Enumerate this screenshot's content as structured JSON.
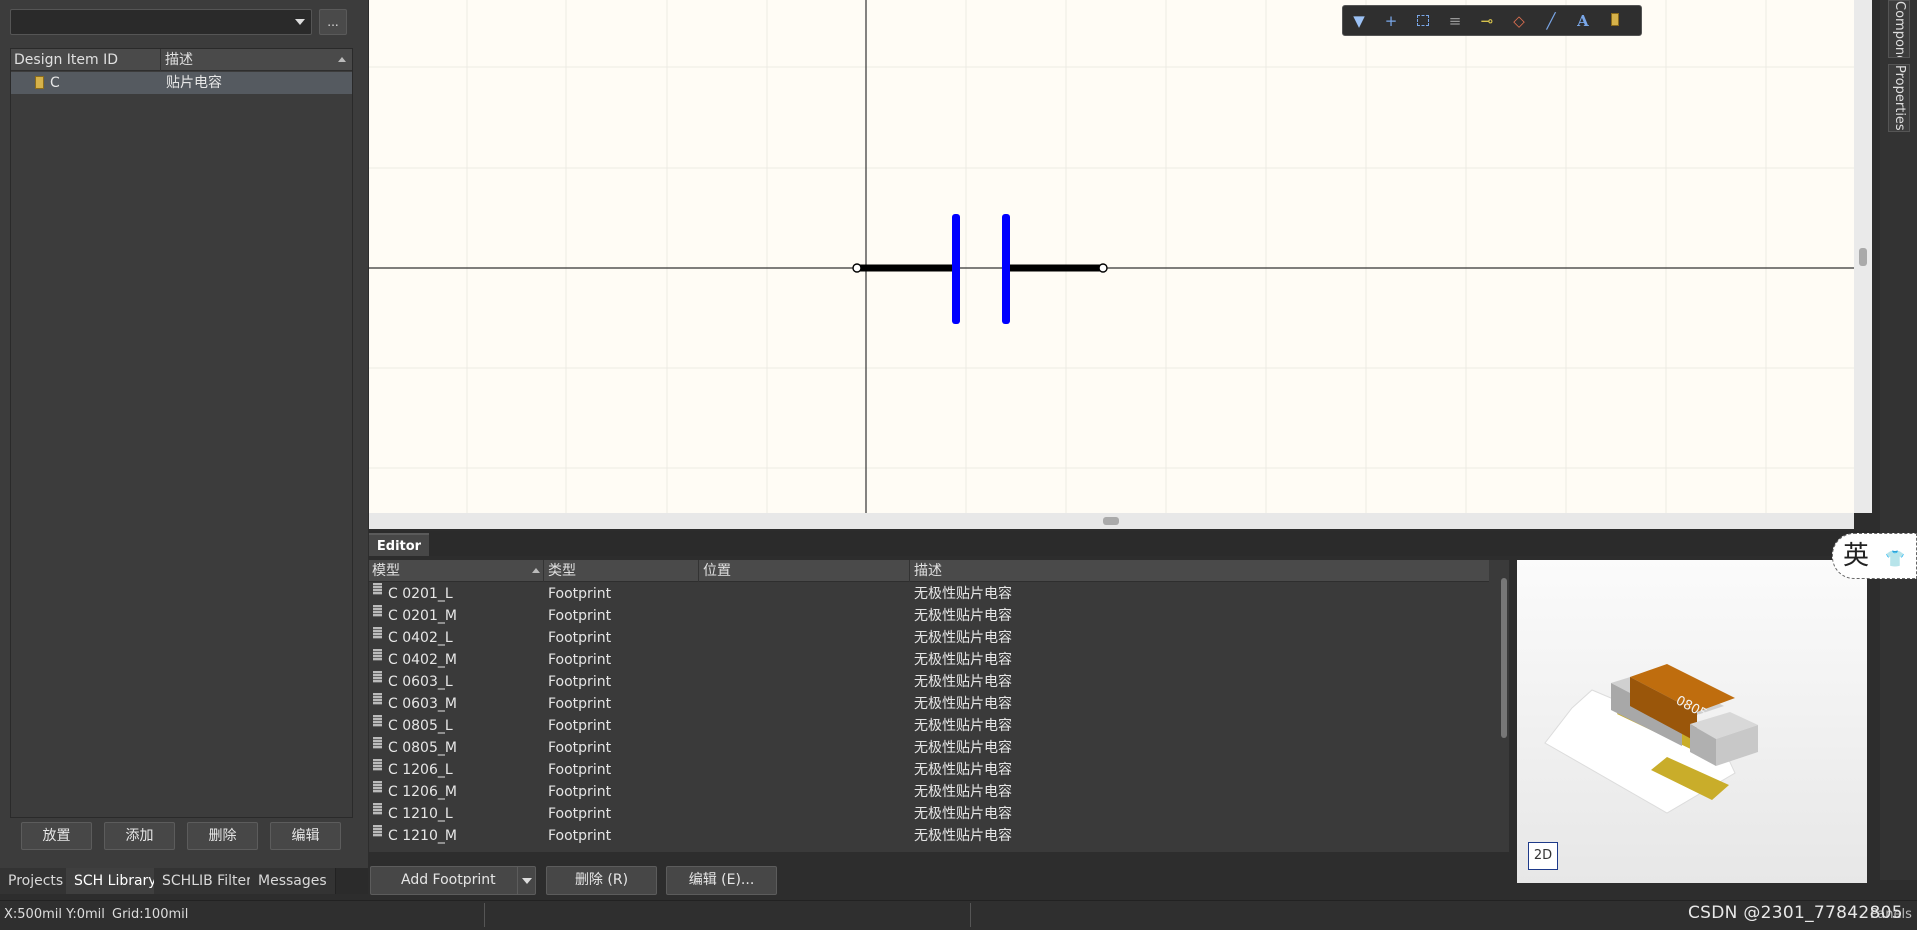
{
  "left_panel": {
    "combo_value": "",
    "more_button": "...",
    "table": {
      "headers": [
        "Design Item ID",
        "描述"
      ],
      "rows": [
        {
          "id": "C",
          "desc": "贴片电容"
        }
      ]
    },
    "buttons": [
      "放置",
      "添加",
      "删除",
      "编辑"
    ],
    "tabs": [
      "Projects",
      "SCH Library",
      "SCHLIB Filter",
      "Messages"
    ]
  },
  "canvas": {
    "background": "#fffcf5",
    "grid_color": "#ecebe4",
    "axis_color": "#333333",
    "pin_color": "#000000",
    "plate_color": "#0000ff",
    "toolbar_icons": [
      "filter-icon",
      "cross-icon",
      "select-rect-icon",
      "align-icon",
      "pin-icon",
      "fill-icon",
      "line-icon",
      "text-icon",
      "component-icon"
    ]
  },
  "right_strip": {
    "tabs": [
      "Components",
      "Properties"
    ]
  },
  "editor": {
    "tab": "Editor",
    "headers": [
      "模型",
      "类型",
      "位置",
      "描述"
    ],
    "rows": [
      {
        "model": "C 0201_L",
        "type": "Footprint",
        "location": "",
        "desc": "无极性贴片电容"
      },
      {
        "model": "C 0201_M",
        "type": "Footprint",
        "location": "",
        "desc": "无极性贴片电容"
      },
      {
        "model": "C 0402_L",
        "type": "Footprint",
        "location": "",
        "desc": "无极性贴片电容"
      },
      {
        "model": "C 0402_M",
        "type": "Footprint",
        "location": "",
        "desc": "无极性贴片电容"
      },
      {
        "model": "C 0603_L",
        "type": "Footprint",
        "location": "",
        "desc": "无极性贴片电容"
      },
      {
        "model": "C 0603_M",
        "type": "Footprint",
        "location": "",
        "desc": "无极性贴片电容"
      },
      {
        "model": "C 0805_L",
        "type": "Footprint",
        "location": "",
        "desc": "无极性贴片电容"
      },
      {
        "model": "C 0805_M",
        "type": "Footprint",
        "location": "",
        "desc": "无极性贴片电容"
      },
      {
        "model": "C 1206_L",
        "type": "Footprint",
        "location": "",
        "desc": "无极性贴片电容"
      },
      {
        "model": "C 1206_M",
        "type": "Footprint",
        "location": "",
        "desc": "无极性贴片电容"
      },
      {
        "model": "C 1210_L",
        "type": "Footprint",
        "location": "",
        "desc": "无极性贴片电容"
      },
      {
        "model": "C 1210_M",
        "type": "Footprint",
        "location": "",
        "desc": "无极性贴片电容"
      }
    ],
    "buttons": {
      "add_footprint": "Add Footprint",
      "delete": "删除 (R)",
      "edit": "编辑 (E)..."
    },
    "preview_label": "0805",
    "preview_button": "2D"
  },
  "ime_indicator": "英",
  "status_bar": {
    "coords": "X:500mil Y:0mil",
    "grid": "Grid:100mil",
    "panels": "Panels"
  },
  "watermark": "CSDN @2301_77842805"
}
